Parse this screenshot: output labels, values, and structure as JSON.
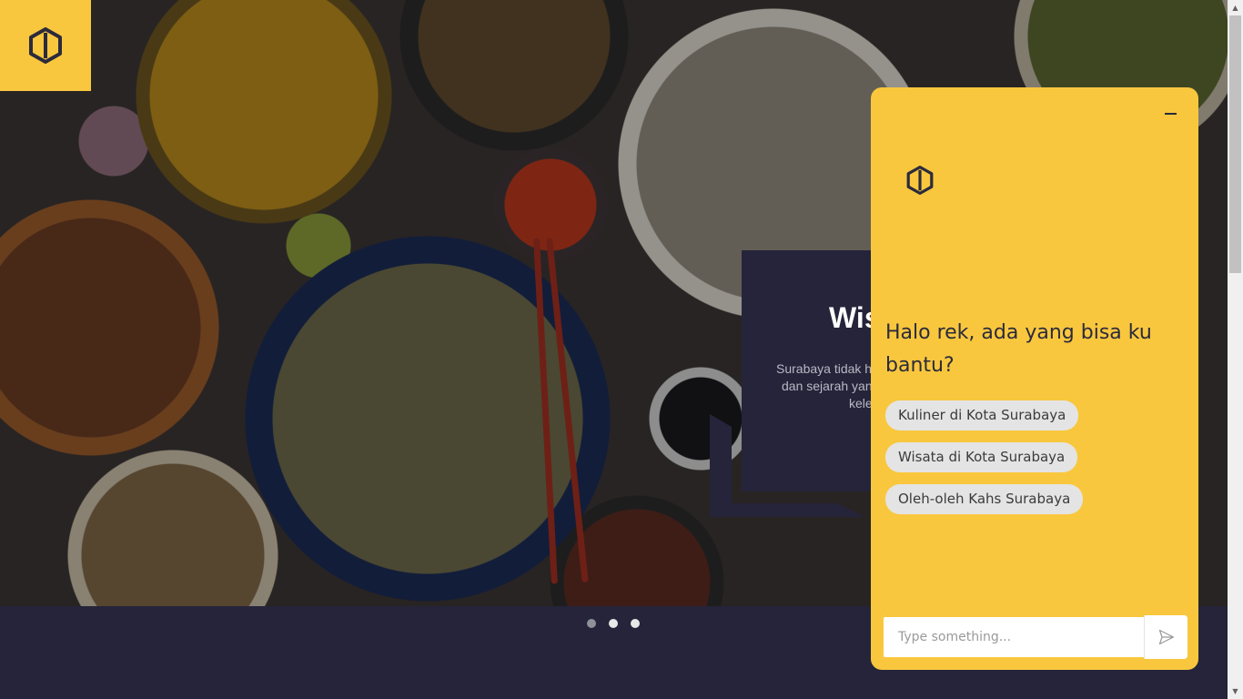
{
  "brand": {
    "logo_icon": "hexagon-logo-icon",
    "accent_color": "#f9c73e",
    "dark_color": "#25243a"
  },
  "hero": {
    "card_title": "Wis",
    "card_text_lines": [
      "Surabaya tidak h",
      "dan sejarah yan",
      "kele"
    ]
  },
  "carousel": {
    "dots": 3,
    "active_index": 0
  },
  "chat": {
    "minimize_icon": "minimize-icon",
    "greeting": "Halo rek, ada yang bisa ku bantu?",
    "suggestions": [
      "Kuliner di Kota Surabaya",
      "Wisata di Kota Surabaya",
      "Oleh-oleh Kahs Surabaya"
    ],
    "input_placeholder": "Type something...",
    "send_icon": "send-icon"
  }
}
